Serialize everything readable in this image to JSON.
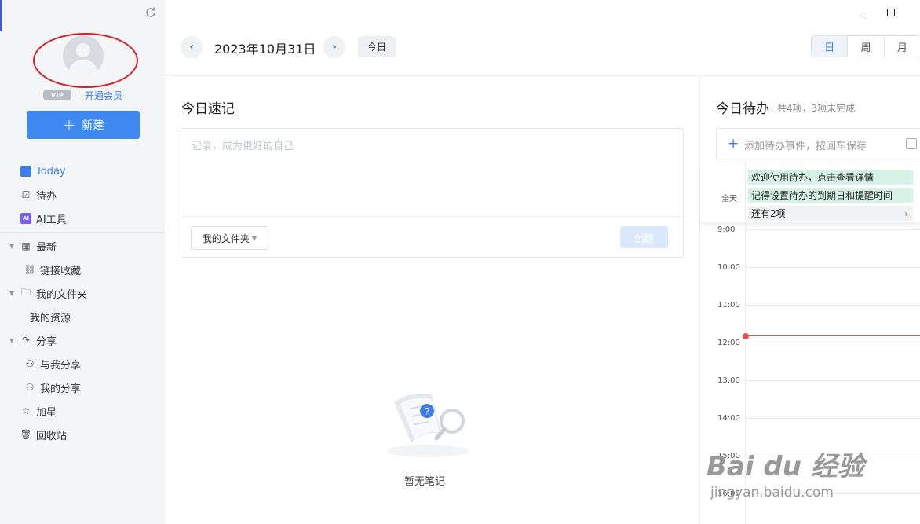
{
  "sidebar": {
    "vip_badge": "VIP",
    "vip_link": "开通会员",
    "new_button": "新建",
    "items": [
      {
        "label": "Today",
        "icon": "calendar-icon"
      },
      {
        "label": "待办",
        "icon": "checkbox-icon"
      },
      {
        "label": "AI工具",
        "icon": "ai-icon"
      },
      {
        "label": "最新",
        "icon": "grid-icon"
      },
      {
        "label": "链接收藏",
        "icon": "link-icon"
      },
      {
        "label": "我的文件夹",
        "icon": "folder-icon"
      },
      {
        "label": "我的资源",
        "icon": ""
      },
      {
        "label": "分享",
        "icon": "share-icon"
      },
      {
        "label": "与我分享",
        "icon": "user-share-icon"
      },
      {
        "label": "我的分享",
        "icon": "user-share-icon"
      },
      {
        "label": "加星",
        "icon": "star-icon"
      },
      {
        "label": "回收站",
        "icon": "trash-icon"
      }
    ]
  },
  "header": {
    "date": "2023年10月31日",
    "today_button": "今日",
    "views": [
      "日",
      "周",
      "月"
    ],
    "active_view": "日"
  },
  "notes": {
    "title": "今日速记",
    "placeholder": "记录，成为更好的自己",
    "folder_select": "我的文件夹",
    "create_button": "创建",
    "empty_text": "暂无笔记"
  },
  "todo": {
    "title": "今日待办",
    "stats": "共4项，3项未完成",
    "input_placeholder": "添加待办事件，按回车保存",
    "allday_label": "全天",
    "events": [
      "欢迎使用待办，点击查看详情",
      "记得设置待办的到期日和提醒时间"
    ],
    "more": "还有2项",
    "hours": [
      "9:00",
      "10:00",
      "11:00",
      "12:00",
      "13:00",
      "14:00",
      "15:00",
      "16:00"
    ]
  },
  "watermark": {
    "brand": "Bai du 经验",
    "url": "jingyan.baidu.com"
  },
  "colors": {
    "accent": "#3f89f0",
    "event_green": "#d6f2e7",
    "now_line": "#e35050",
    "annotation": "#d0202a"
  }
}
